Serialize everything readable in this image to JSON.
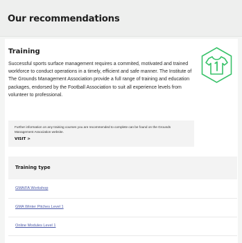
{
  "header": {
    "title": "Our recommendations"
  },
  "training": {
    "title": "Training",
    "description": "Successful sports surface management requires a commited, motivated and trained workforce to conduct operations in a timely, efficient and safe manner. The Institute of The Grounds Management Association provide a full range of training and education packages, endorsed by the Football Association to suit all experience levels from volunteer to professional.",
    "icon": "shirt-number-1-icon",
    "icon_color": "#39c26a",
    "info": {
      "text": "Further information on any training courses you are recommended to complete can be found on the Grounds Management Association website.",
      "visit_label": "VISIT >"
    },
    "table": {
      "header": "Training type",
      "rows": [
        "GMA/FA Workshop",
        "GMA Winter Pitches Level 1",
        "Online Modules Level 1"
      ]
    }
  },
  "colors": {
    "link": "#4a58a8",
    "accent": "#39c26a"
  }
}
